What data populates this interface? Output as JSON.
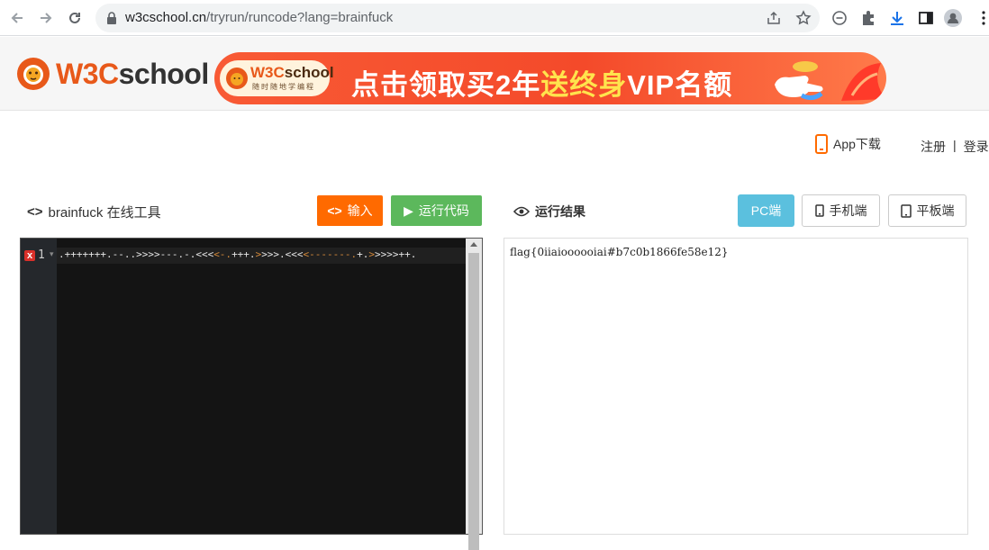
{
  "browser": {
    "url_host": "w3cschool.cn",
    "url_path": "/tryrun/runcode?lang=brainfuck"
  },
  "header": {
    "logo_w3c": "W3C",
    "logo_school": "school",
    "banner": {
      "pill_w3c": "W3C",
      "pill_school": "school",
      "pill_sub": "随时随地学编程",
      "promo_a": "点击领取买2年",
      "promo_b": "送终身",
      "promo_c": "VIP名额"
    }
  },
  "user": {
    "app_download": "App下载",
    "register": "注册",
    "separator": "|",
    "login": "登录"
  },
  "tool": {
    "title_glyph": "<>",
    "title": "brainfuck 在线工具",
    "input_glyph": "<>",
    "input_label": "输入",
    "run_glyph": "▶",
    "run_label": "运行代码"
  },
  "editor": {
    "line_number": "1",
    "error_marker": "x",
    "code_segments": [
      {
        "text": ".+++++++.--..>>>>---.-.<<<",
        "op": false
      },
      {
        "text": "<-.",
        "op": true
      },
      {
        "text": "+++.",
        "op": false
      },
      {
        "text": ">",
        "op": true
      },
      {
        "text": ">>>.<<<",
        "op": false
      },
      {
        "text": "<-------.",
        "op": true
      },
      {
        "text": "+.",
        "op": false
      },
      {
        "text": ">",
        "op": true
      },
      {
        "text": ">>>>++.",
        "op": false
      }
    ]
  },
  "result": {
    "title": "运行结果",
    "view_pc": "PC端",
    "view_mobile": "手机端",
    "view_tablet": "平板端",
    "output": "flag{0iiaioooooiai#b7c0b1866fe58e12}"
  },
  "colors": {
    "accent_orange": "#ff6a00",
    "run_green": "#5cb85c",
    "pc_blue": "#5bc0de",
    "banner_red": "#f44a2a"
  }
}
